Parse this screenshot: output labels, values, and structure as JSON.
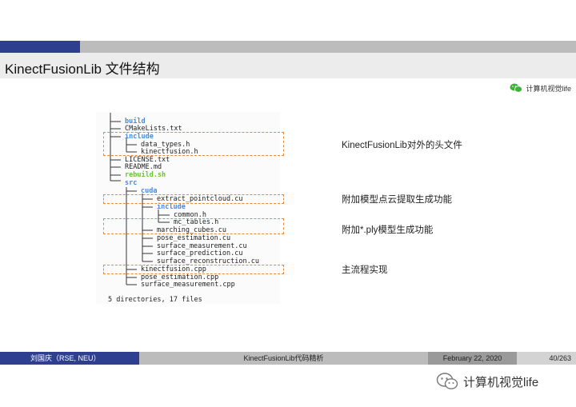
{
  "slide": {
    "title": "KinectFusionLib 文件结构",
    "badge_text": "计算机视觉life"
  },
  "tree": {
    "items": [
      {
        "label": "build",
        "kind": "dir"
      },
      {
        "label": "CMakeLists.txt",
        "kind": "file"
      },
      {
        "label": "include",
        "kind": "dir"
      },
      {
        "label": "data_types.h",
        "kind": "file"
      },
      {
        "label": "kinectfusion.h",
        "kind": "file"
      },
      {
        "label": "LICENSE.txt",
        "kind": "file"
      },
      {
        "label": "README.md",
        "kind": "file"
      },
      {
        "label": "rebuild.sh",
        "kind": "exec"
      },
      {
        "label": "src",
        "kind": "dir"
      },
      {
        "label": "cuda",
        "kind": "dir"
      },
      {
        "label": "extract_pointcloud.cu",
        "kind": "file"
      },
      {
        "label": "include",
        "kind": "dir"
      },
      {
        "label": "common.h",
        "kind": "file"
      },
      {
        "label": "mc_tables.h",
        "kind": "file"
      },
      {
        "label": "marching_cubes.cu",
        "kind": "file"
      },
      {
        "label": "pose_estimation.cu",
        "kind": "file"
      },
      {
        "label": "surface_measurement.cu",
        "kind": "file"
      },
      {
        "label": "surface_prediction.cu",
        "kind": "file"
      },
      {
        "label": "surface_reconstruction.cu",
        "kind": "file"
      },
      {
        "label": "kinectfusion.cpp",
        "kind": "file"
      },
      {
        "label": "pose_estimation.cpp",
        "kind": "file"
      },
      {
        "label": "surface_measurement.cpp",
        "kind": "file"
      }
    ],
    "summary": "5 directories, 17 files"
  },
  "annotations": [
    {
      "text": "KinectFusionLib对外的头文件"
    },
    {
      "text": "附加模型点云提取生成功能"
    },
    {
      "text": "附加*.ply模型生成功能"
    },
    {
      "text": "主流程实现"
    }
  ],
  "footer": {
    "author": "刘国庆（RSE, NEU）",
    "title": "KinectFusionLib代码精析",
    "date": "February 22, 2020",
    "page": "40/263"
  },
  "watermark": {
    "text": "计算机视觉life"
  },
  "colors": {
    "accent_blue": "#2e3f8f",
    "dir_blue": "#4a8ad9",
    "exec_green": "#6cbe3c",
    "annotation_orange": "#e58a3a",
    "wechat_green": "#3fb13a"
  }
}
